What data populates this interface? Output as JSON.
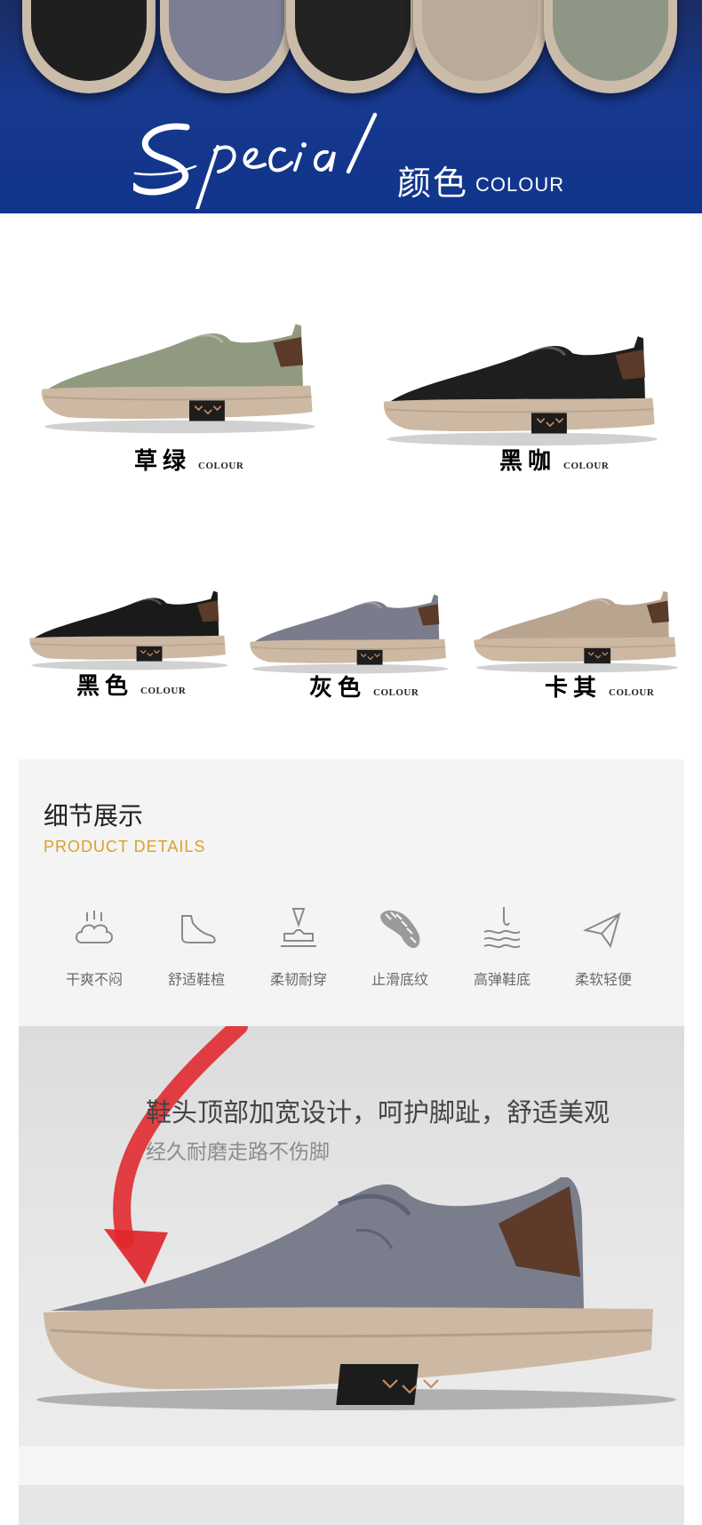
{
  "banner": {
    "script_word": "Special",
    "title_cn": "颜色",
    "title_en": "COLOUR",
    "shoe_colors": [
      "#1f1f1f",
      "#7c7f94",
      "#222222",
      "#b9aa9b",
      "#8e9686"
    ]
  },
  "colours": [
    {
      "name": "草绿",
      "tag": "COLOUR",
      "upper": "#8f9a80",
      "label_color": "#6b7b3d"
    },
    {
      "name": "黑咖",
      "tag": "COLOUR",
      "upper": "#1e1e1e",
      "label_color": "#111111"
    },
    {
      "name": "黑色",
      "tag": "COLOUR",
      "upper": "#1a1a1a",
      "label_color": "#111111"
    },
    {
      "name": "灰色",
      "tag": "COLOUR",
      "upper": "#7a7c8c",
      "label_color": "#555555"
    },
    {
      "name": "卡其",
      "tag": "COLOUR",
      "upper": "#b8a48f",
      "label_color": "#6d5a3d"
    }
  ],
  "details": {
    "title": "细节展示",
    "subtitle": "PRODUCT DETAILS",
    "features": [
      {
        "label": "干爽不闷",
        "icon": "cloud-steam-icon"
      },
      {
        "label": "舒适鞋楦",
        "icon": "foot-last-icon"
      },
      {
        "label": "柔韧耐穿",
        "icon": "press-durability-icon"
      },
      {
        "label": "止滑底纹",
        "icon": "sole-tread-icon"
      },
      {
        "label": "高弹鞋底",
        "icon": "bounce-wave-icon"
      },
      {
        "label": "柔软轻便",
        "icon": "paper-plane-icon"
      }
    ]
  },
  "hero": {
    "line1": "鞋头顶部加宽设计，呵护脚趾，舒适美观",
    "line2": "经久耐磨走路不伤脚",
    "shoe_color": "#7a7d8c",
    "arrow_color": "#e0262b"
  },
  "colors": {
    "banner_blue": "#17388d",
    "accent_gold": "#d8a12c",
    "sole_beige": "#cdb9a3"
  }
}
